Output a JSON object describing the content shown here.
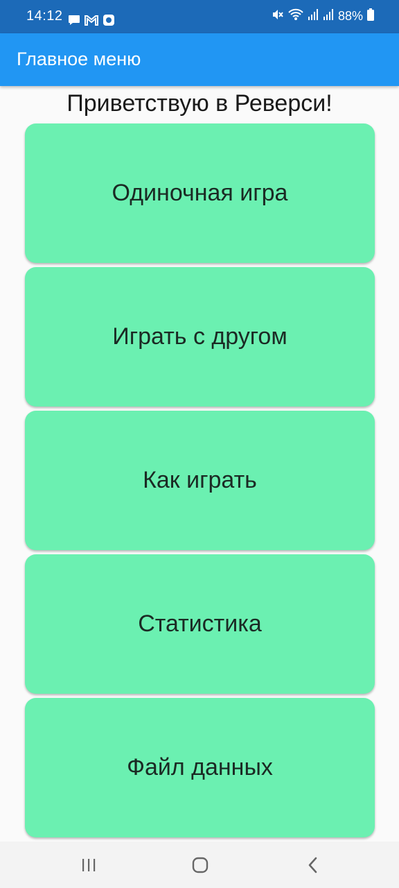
{
  "status_bar": {
    "time": "14:12",
    "battery": "88%",
    "icons": [
      "chat-icon",
      "gmail-icon",
      "app-icon",
      "mute-icon",
      "wifi-icon",
      "signal-icon",
      "signal-icon",
      "battery-icon"
    ]
  },
  "app_bar": {
    "title": "Главное меню"
  },
  "main": {
    "welcome": "Приветствую в Реверси!",
    "buttons": [
      {
        "label": "Одиночная игра"
      },
      {
        "label": "Играть с другом"
      },
      {
        "label": "Как играть"
      },
      {
        "label": "Статистика"
      },
      {
        "label": "Файл данных"
      }
    ]
  },
  "nav_bar": {
    "icons": [
      "recent-apps-icon",
      "home-icon",
      "back-icon"
    ]
  },
  "colors": {
    "status_bar": "#1c6ab8",
    "app_bar": "#2196f3",
    "button": "#6bf0b1",
    "background": "#fafafa"
  }
}
